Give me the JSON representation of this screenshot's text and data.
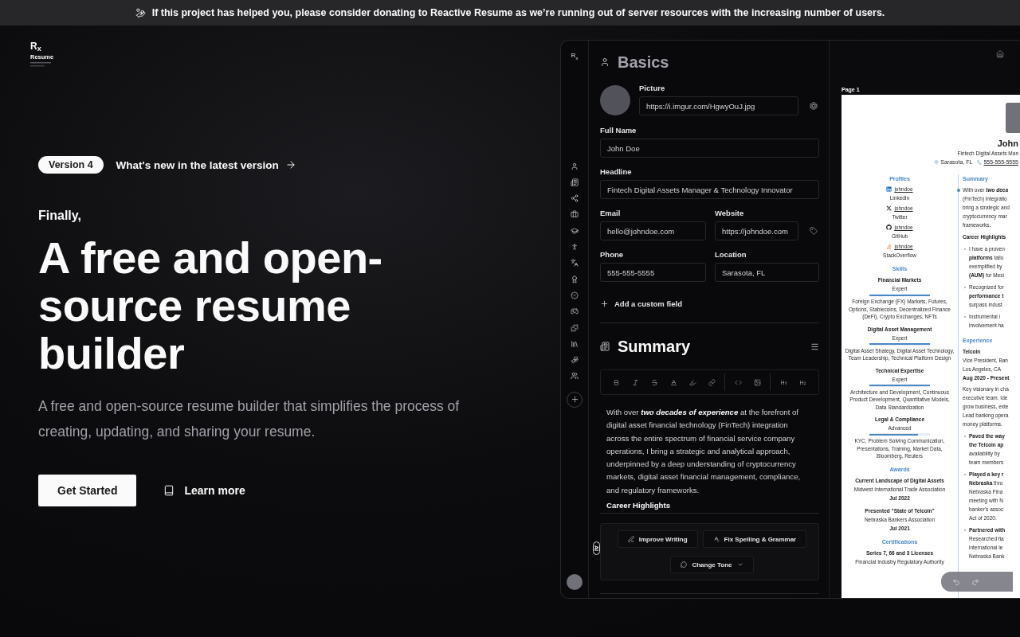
{
  "banner": {
    "text": "If this project has helped you, please consider donating to Reactive Resume as we’re running out of server resources with the increasing number of users."
  },
  "logo": {
    "mark": "R$_{x}$",
    "word": "Resume"
  },
  "hero": {
    "badge": "Version 4",
    "news_link": "What's new in the latest version",
    "kicker": "Finally,",
    "title": "A free and open-source resume builder",
    "description": "A free and open-source resume builder that simplifies the process of creating, updating, and sharing your resume.",
    "buttons": [
      {
        "label": "Get Started",
        "kind": "primary"
      },
      {
        "label": "Learn more",
        "kind": "ghost"
      }
    ]
  },
  "editor": {
    "rail_logo": "R$_{x}$",
    "basics": {
      "title": "Basics",
      "picture_label": "Picture",
      "picture_url": "https://i.imgur.com/HgwyOuJ.jpg",
      "full_name": {
        "label": "Full Name",
        "value": "John Doe"
      },
      "headline": {
        "label": "Headline",
        "value": "Fintech Digital Assets Manager & Technology Innovator"
      },
      "email": {
        "label": "Email",
        "value": "hello@johndoe.com"
      },
      "website": {
        "label": "Website",
        "value": "https://johndoe.com"
      },
      "phone": {
        "label": "Phone",
        "value": "555-555-5555"
      },
      "location": {
        "label": "Location",
        "value": "Sarasota, FL"
      },
      "add_field": "Add a custom field"
    },
    "summary": {
      "title": "Summary",
      "text": "With over **two decades of experience** at the forefront of digital asset financial technology (FinTech) integration across the entire spectrum of financial service company operations, I bring a strategic and analytical approach, underpinned by a deep understanding of cryptocurrency markets, digital asset financial management, compliance, and regulatory frameworks.",
      "subheading": "Career Highlights",
      "ai_tag": "AI",
      "ai_buttons": [
        {
          "label": "Improve Writing",
          "kind": "improve"
        },
        {
          "label": "Fix Spelling & Grammar",
          "kind": "fix"
        },
        {
          "label": "Change Tone",
          "kind": "tone"
        }
      ]
    }
  },
  "preview": {
    "page_label": "Page 1",
    "resume": {
      "name": "John",
      "headline": "Fintech Digital Assets Man",
      "contacts": [
        {
          "kind": "location",
          "text": "Sarasota, FL"
        },
        {
          "kind": "phone",
          "text": "555-555-5555"
        }
      ],
      "profiles_heading": "Profiles",
      "profiles": [
        {
          "kind": "linkedin",
          "username": "johndoe",
          "network": "LinkedIn"
        },
        {
          "kind": "x",
          "username": "johndoe",
          "network": "Twitter"
        },
        {
          "kind": "github",
          "username": "johndoe",
          "network": "GitHub"
        },
        {
          "kind": "stackoverflow",
          "username": "johndoe",
          "network": "StackOverflow"
        }
      ],
      "skills_heading": "Skills",
      "skills": [
        {
          "name": "Financial Markets",
          "level_text": "Expert",
          "level": 1,
          "keywords": "Foreign Exchange (FX) Markets, Futures, Options, Stablecoins, Decentralized Finance (DeFi), Crypto Exchanges, NFTs"
        },
        {
          "name": "Digital Asset Management",
          "level_text": "Expert",
          "level": 1,
          "keywords": "Digital Asset Strategy, Digital Asset Technology, Team Leadership, Technical Platform Design"
        },
        {
          "name": "Technical Expertise",
          "level_text": "Expert",
          "level": 1,
          "keywords": "Architecture and Development, Continuous Product Development, Quantitative Models, Data Standardization"
        },
        {
          "name": "Legal & Compliance",
          "level_text": "Advanced",
          "level": 0.8,
          "keywords": "KYC, Problem Solving Communication, Presentations, Training, Market Data, Bloomberg, Reuters"
        }
      ],
      "awards_heading": "Awards",
      "awards": [
        {
          "title": "Current Landscape of Digital Assets",
          "awarder": "Midwest International Trade Association",
          "date": "Jul 2022"
        },
        {
          "title": "Presented \"State of Telcoin\"",
          "awarder": "Nebraska Bankers Association",
          "date": "Jul 2021"
        }
      ],
      "certifications_heading": "Certifications",
      "certifications": [
        {
          "name": "Series 7, 66 and 3 Licenses",
          "issuer": "Financial Industry Regulatory Authority"
        }
      ],
      "summary_heading": "Summary",
      "summary_lines": [
        "With over **two deca**",
        "(FinTech) integratio",
        "bring a strategic and",
        "cryptocurrency mar",
        "frameworks."
      ],
      "highlights_heading": "Career Highlights",
      "highlights": [
        [
          "I have a proven",
          "**platforms** tailo",
          "exemplified by",
          "**(AUM)** for Mesi"
        ],
        [
          "Recognized for",
          "**performance t**",
          "surpass indust"
        ],
        [
          "Instrumental i",
          "involvement ha"
        ]
      ],
      "experience_heading": "Experience",
      "experience": {
        "company": "Telcoin",
        "position": "Vice President, Ban",
        "location": "Los Angeles, CA",
        "date": "Aug 2020 - Present",
        "lines": [
          "Key visionary in cha",
          "executive team. Ide",
          "grow business, exte",
          "Lead banking opera",
          "money platforms."
        ],
        "bullets": [
          [
            "**Paved the way**",
            "**the Telcoin ap**",
            "availability by",
            "team members"
          ],
          [
            "**Played a key r**",
            "**Nebraska** thro",
            "Nebraska Fina",
            "meeting with N",
            "banker's assoc",
            "Act of 2020."
          ],
          [
            "**Partnered with**",
            "Researched fia",
            "international le",
            "Nebraska Bank"
          ]
        ]
      }
    }
  }
}
